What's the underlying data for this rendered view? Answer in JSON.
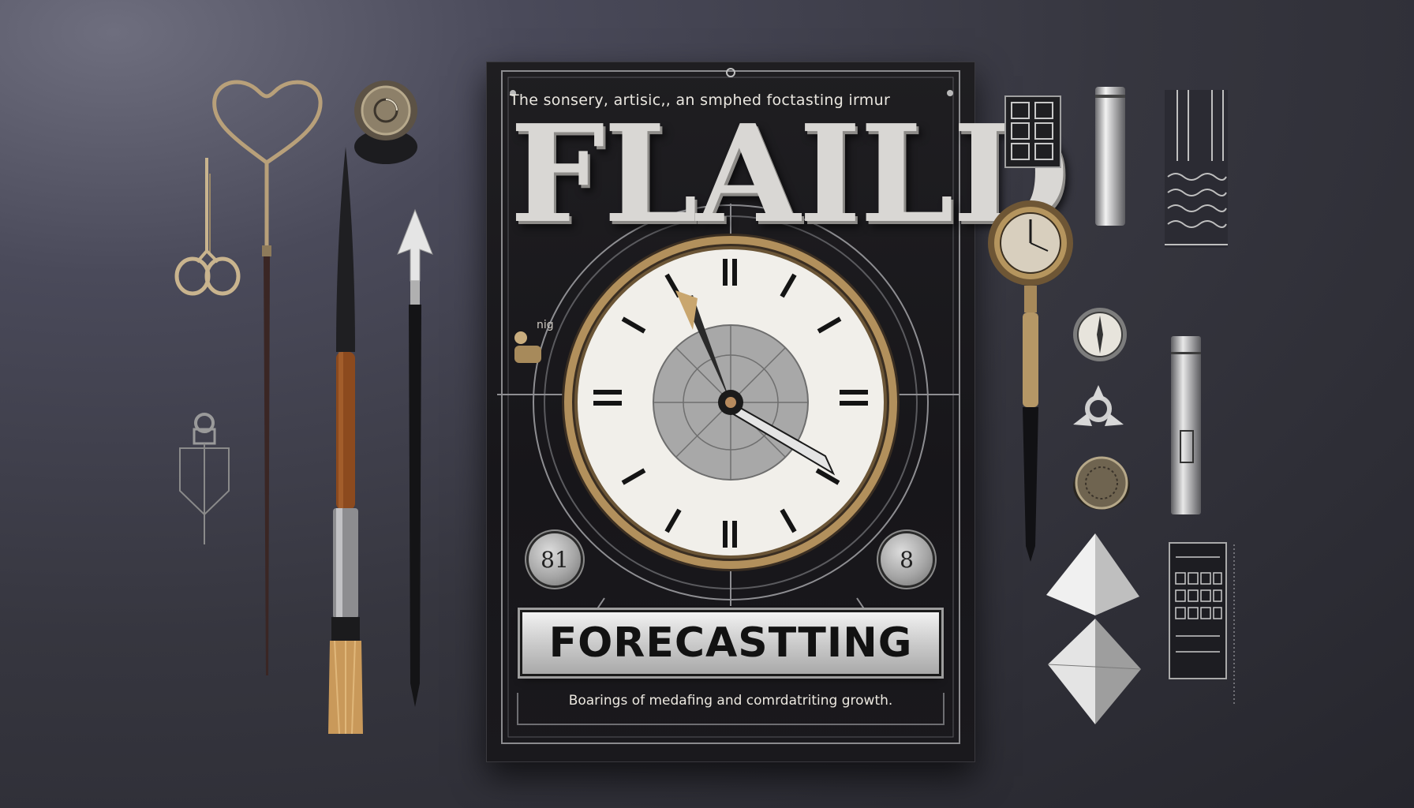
{
  "poster": {
    "tagline": "The sonsery, artisic,, an smphed foctasting irmur",
    "title": "FLAILD",
    "small_mark": "nig",
    "left_medallion": "8‌1",
    "right_medallion": "8",
    "plaque_text": "FORECASTTING",
    "subtitle": "Boarings of medafing and comrdatriting growth."
  },
  "colors": {
    "background": "#34343d",
    "poster": "#1a191d",
    "metal": "#c8c8c8",
    "brass": "#a98a55"
  }
}
